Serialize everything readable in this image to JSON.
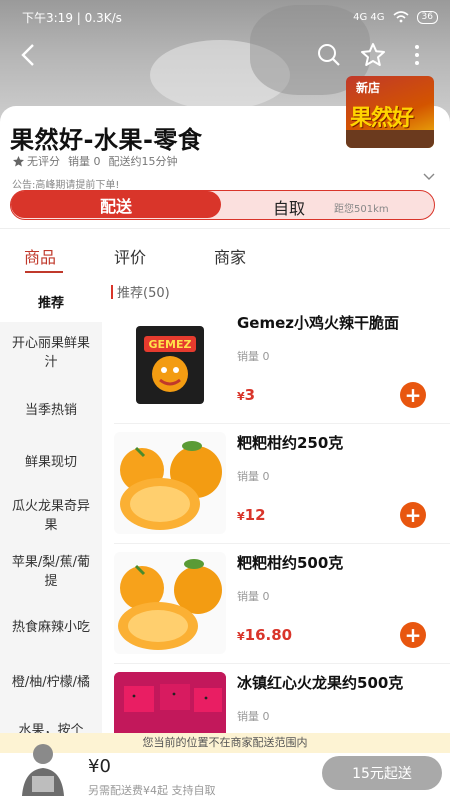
{
  "status_bar": {
    "time": "下午3:19 | 0.3K/s",
    "network": "4G  4G",
    "battery": "36"
  },
  "store": {
    "name": "果然好-水果-零食",
    "rating": "无评分",
    "sales": "销量 0",
    "delivery_time": "配送约15分钟",
    "notice": "公告:高峰期请提前下单!",
    "logo_badge": "新店",
    "logo_text": "果然好"
  },
  "toggle": {
    "delivery": "配送",
    "pickup": "自取",
    "distance": "距您501km"
  },
  "tabs": [
    {
      "label": "商品"
    },
    {
      "label": "评价"
    },
    {
      "label": "商家"
    }
  ],
  "categories": [
    {
      "label": "推荐"
    },
    {
      "label": "开心丽果鲜果汁"
    },
    {
      "label": "当季热销"
    },
    {
      "label": "鲜果现切"
    },
    {
      "label": "瓜火龙果奇异果"
    },
    {
      "label": "苹果/梨/蕉/葡提"
    },
    {
      "label": "热食麻辣小吃"
    },
    {
      "label": "橙/柚/柠檬/橘"
    },
    {
      "label": "水果，按个"
    }
  ],
  "section": {
    "label": "推荐(50)"
  },
  "products": [
    {
      "name": "Gemez小鸡火辣干脆面",
      "sales": "销量 0",
      "currency": "¥",
      "price": "3",
      "add": "+",
      "pack_text": "GEMEZ"
    },
    {
      "name": "粑粑柑约250克",
      "sales": "销量 0",
      "currency": "¥",
      "price": "12",
      "add": "+"
    },
    {
      "name": "粑粑柑约500克",
      "sales": "销量 0",
      "currency": "¥",
      "price": "16.80",
      "add": "+"
    },
    {
      "name": "冰镇红心火龙果约500克",
      "sales": "销量 0",
      "currency": "¥",
      "price": "",
      "add": "+"
    }
  ],
  "warning": "您当前的位置不在商家配送范围内",
  "cart": {
    "amount": "¥0",
    "extra": "另需配送费¥4起  支持自取",
    "checkout": "15元起送"
  },
  "colors": {
    "accent": "#d9352a",
    "add_button": "#e8560f",
    "checkout_disabled": "#a9a9a9"
  }
}
